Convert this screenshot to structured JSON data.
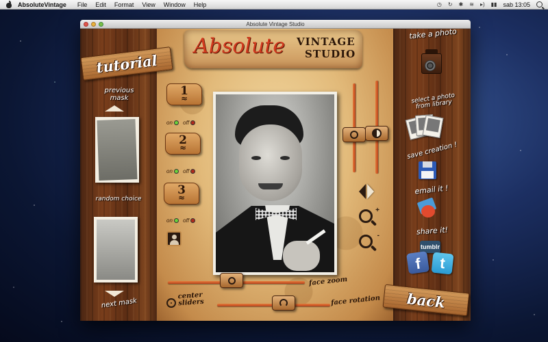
{
  "menubar": {
    "app_name": "AbsoluteVintage",
    "items": [
      "File",
      "Edit",
      "Format",
      "View",
      "Window",
      "Help"
    ],
    "clock": "sab 13:05"
  },
  "window": {
    "title": "Absolute Vintage Studio"
  },
  "logo": {
    "absolute": "Absolute",
    "vintage": "VINTAGE",
    "studio": "STUDIO"
  },
  "left_panel": {
    "tutorial": "tutorial",
    "previous_mask": "previous\nmask",
    "random_choice": "random choice",
    "next_mask": "next mask"
  },
  "masks": [
    {
      "number": "1",
      "on": "on",
      "off": "off"
    },
    {
      "number": "2",
      "on": "on",
      "off": "off"
    },
    {
      "number": "3",
      "on": "on",
      "off": "off"
    }
  ],
  "bottom_controls": {
    "face_zoom": "face zoom",
    "face_rotation": "face rotation",
    "center_sliders": "center\nsliders"
  },
  "right_panel": {
    "take_photo": "take a photo",
    "select_photo": "select a photo\nfrom library",
    "save_creation": "save creation !",
    "email_it": "email it !",
    "share_it": "share it!",
    "tumblr": "tumblr",
    "facebook": "f",
    "twitter": "t",
    "back": "back"
  }
}
